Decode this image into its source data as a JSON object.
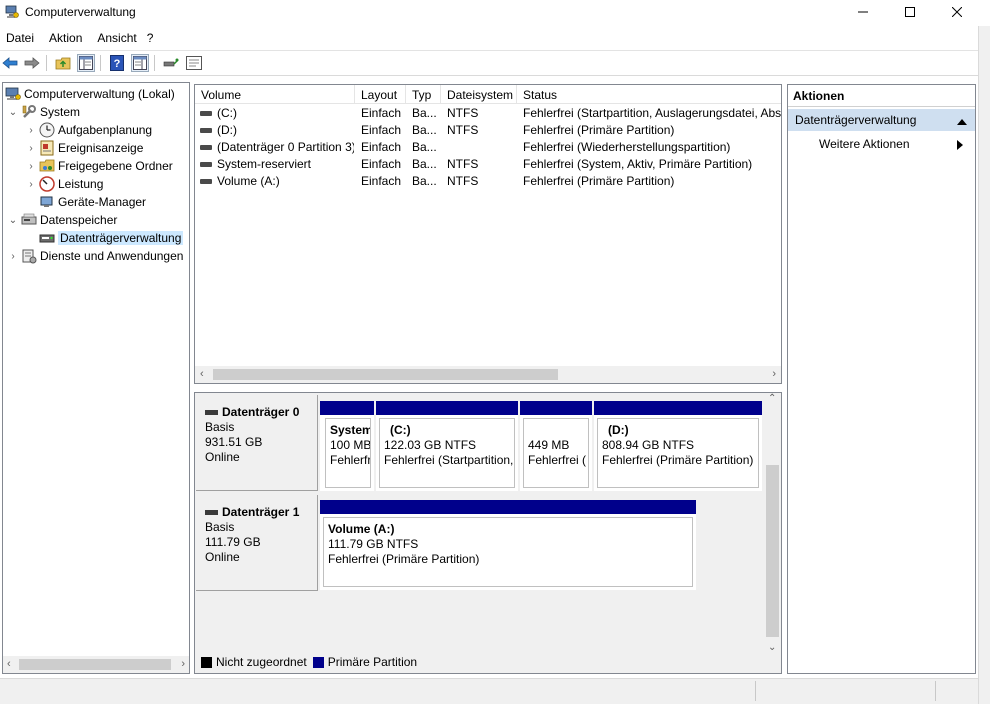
{
  "window": {
    "title": "Computerverwaltung",
    "minimize": "—",
    "maximize": "☐",
    "close": "✕"
  },
  "menu": [
    "Datei",
    "Aktion",
    "Ansicht",
    "?"
  ],
  "toolbar_icons": [
    "back-arrow",
    "forward-arrow",
    "up-folder",
    "show-hide-console-tree",
    "help",
    "properties",
    "connect",
    "settings"
  ],
  "tree": {
    "items": [
      {
        "label": "Computerverwaltung (Lokal)",
        "arrow": "",
        "icon": "computer-management-icon"
      },
      {
        "label": "System",
        "arrow": "⌄",
        "icon": "system-tools-icon"
      },
      {
        "label": "Aufgabenplanung",
        "arrow": "›",
        "icon": "clock-icon"
      },
      {
        "label": "Ereignisanzeige",
        "arrow": "›",
        "icon": "event-viewer-icon"
      },
      {
        "label": "Freigegebene Ordner",
        "arrow": "›",
        "icon": "shared-folder-icon"
      },
      {
        "label": "Leistung",
        "arrow": "›",
        "icon": "performance-icon"
      },
      {
        "label": "Geräte-Manager",
        "arrow": "",
        "icon": "device-manager-icon"
      },
      {
        "label": "Datenspeicher",
        "arrow": "⌄",
        "icon": "storage-icon"
      },
      {
        "label": "Datenträgerverwaltung",
        "arrow": "",
        "icon": "disk-management-icon"
      },
      {
        "label": "Dienste und Anwendungen",
        "arrow": "›",
        "icon": "services-icon"
      }
    ]
  },
  "list": {
    "columns": [
      "Volume",
      "Layout",
      "Typ",
      "Dateisystem",
      "Status"
    ],
    "rows": [
      {
        "volume": "(C:)",
        "layout": "Einfach",
        "typ": "Ba...",
        "fs": "NTFS",
        "status": "Fehlerfrei (Startpartition, Auslagerungsdatei, Abst"
      },
      {
        "volume": "(D:)",
        "layout": "Einfach",
        "typ": "Ba...",
        "fs": "NTFS",
        "status": "Fehlerfrei (Primäre Partition)"
      },
      {
        "volume": "(Datenträger 0 Partition 3)",
        "layout": "Einfach",
        "typ": "Ba...",
        "fs": "",
        "status": "Fehlerfrei (Wiederherstellungspartition)"
      },
      {
        "volume": "System-reserviert",
        "layout": "Einfach",
        "typ": "Ba...",
        "fs": "NTFS",
        "status": "Fehlerfrei (System, Aktiv, Primäre Partition)"
      },
      {
        "volume": "Volume (A:)",
        "layout": "Einfach",
        "typ": "Ba...",
        "fs": "NTFS",
        "status": "Fehlerfrei (Primäre Partition)"
      }
    ]
  },
  "disks": [
    {
      "name": "Datenträger 0",
      "type": "Basis",
      "size": "931.51 GB",
      "state": "Online",
      "partitions": [
        {
          "name": "System",
          "size": "100 MB",
          "status": "Fehlerfr"
        },
        {
          "name": "(C:)",
          "size": "122.03 GB NTFS",
          "status": "Fehlerfrei (Startpartition,"
        },
        {
          "name": "",
          "size": "449 MB",
          "status": "Fehlerfrei ("
        },
        {
          "name": "(D:)",
          "size": "808.94 GB NTFS",
          "status": "Fehlerfrei (Primäre Partition)"
        }
      ]
    },
    {
      "name": "Datenträger 1",
      "type": "Basis",
      "size": "111.79 GB",
      "state": "Online",
      "partitions": [
        {
          "name": "Volume  (A:)",
          "size": "111.79 GB NTFS",
          "status": "Fehlerfrei (Primäre Partition)"
        }
      ]
    }
  ],
  "legend": [
    {
      "label": "Nicht zugeordnet",
      "color": "#000000"
    },
    {
      "label": "Primäre Partition",
      "color": "#00008b"
    }
  ],
  "actions": {
    "title": "Aktionen",
    "group": "Datenträgerverwaltung",
    "item": "Weitere Aktionen"
  },
  "colors": {
    "primary_partition": "#00008b",
    "selection": "#cce8ff",
    "action_group": "#cfdff0"
  }
}
